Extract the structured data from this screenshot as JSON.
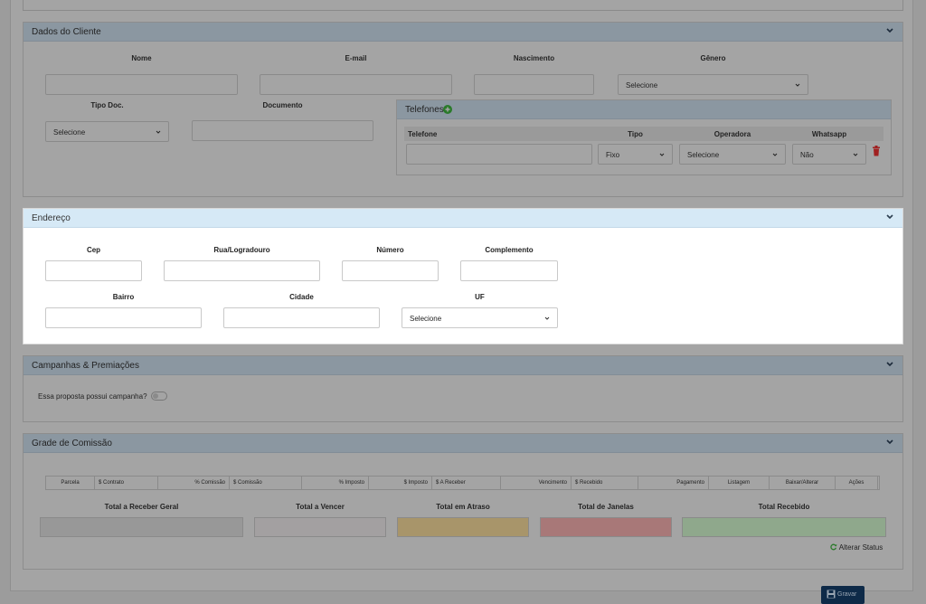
{
  "dados_cliente": {
    "title": "Dados do Cliente",
    "labels": {
      "nome": "Nome",
      "email": "E-mail",
      "nascimento": "Nascimento",
      "genero": "Gênero",
      "tipo_doc": "Tipo Doc.",
      "documento": "Documento"
    },
    "genero_value": "Selecione",
    "tipo_doc_value": "Selecione",
    "telefones": {
      "title": "Telefones",
      "columns": {
        "telefone": "Telefone",
        "tipo": "Tipo",
        "operadora": "Operadora",
        "whatsapp": "Whatsapp"
      },
      "row": {
        "tipo": "Fixo",
        "operadora": "Selecione",
        "whatsapp": "Não"
      }
    }
  },
  "endereco": {
    "title": "Endereço",
    "labels": {
      "cep": "Cep",
      "rua": "Rua/Logradouro",
      "numero": "Número",
      "complemento": "Complemento",
      "bairro": "Bairro",
      "cidade": "Cidade",
      "uf": "UF"
    },
    "uf_value": "Selecione"
  },
  "campanhas": {
    "title": "Campanhas & Premiações",
    "question": "Essa proposta possui campanha?"
  },
  "grade": {
    "title": "Grade de Comissão",
    "columns": [
      "Parcela",
      "$ Contrato",
      "% Comissão",
      "$ Comissão",
      "% Imposto",
      "$ Imposto",
      "$ A Receber",
      "Vencimento",
      "$ Recebido",
      "Pagamento",
      "Listagem",
      "Baixar/Alterar",
      "Ações"
    ],
    "totals": [
      "Total a Receber Geral",
      "Total a Vencer",
      "Total em Atraso",
      "Total de Janelas",
      "Total Recebido"
    ],
    "total_colors": [
      "#989898",
      "#a3a0a1",
      "#a8956a",
      "#a87878",
      "#8fa88c"
    ],
    "alterar_status": "Alterar Status"
  },
  "actions": {
    "save_label": "Gravar"
  },
  "colors": {
    "header": "#8b97a1",
    "active_header": "#d6e9f6",
    "overlay": "#a4a4a4",
    "accent_green": "#2a7a2a",
    "danger": "#a02020"
  }
}
